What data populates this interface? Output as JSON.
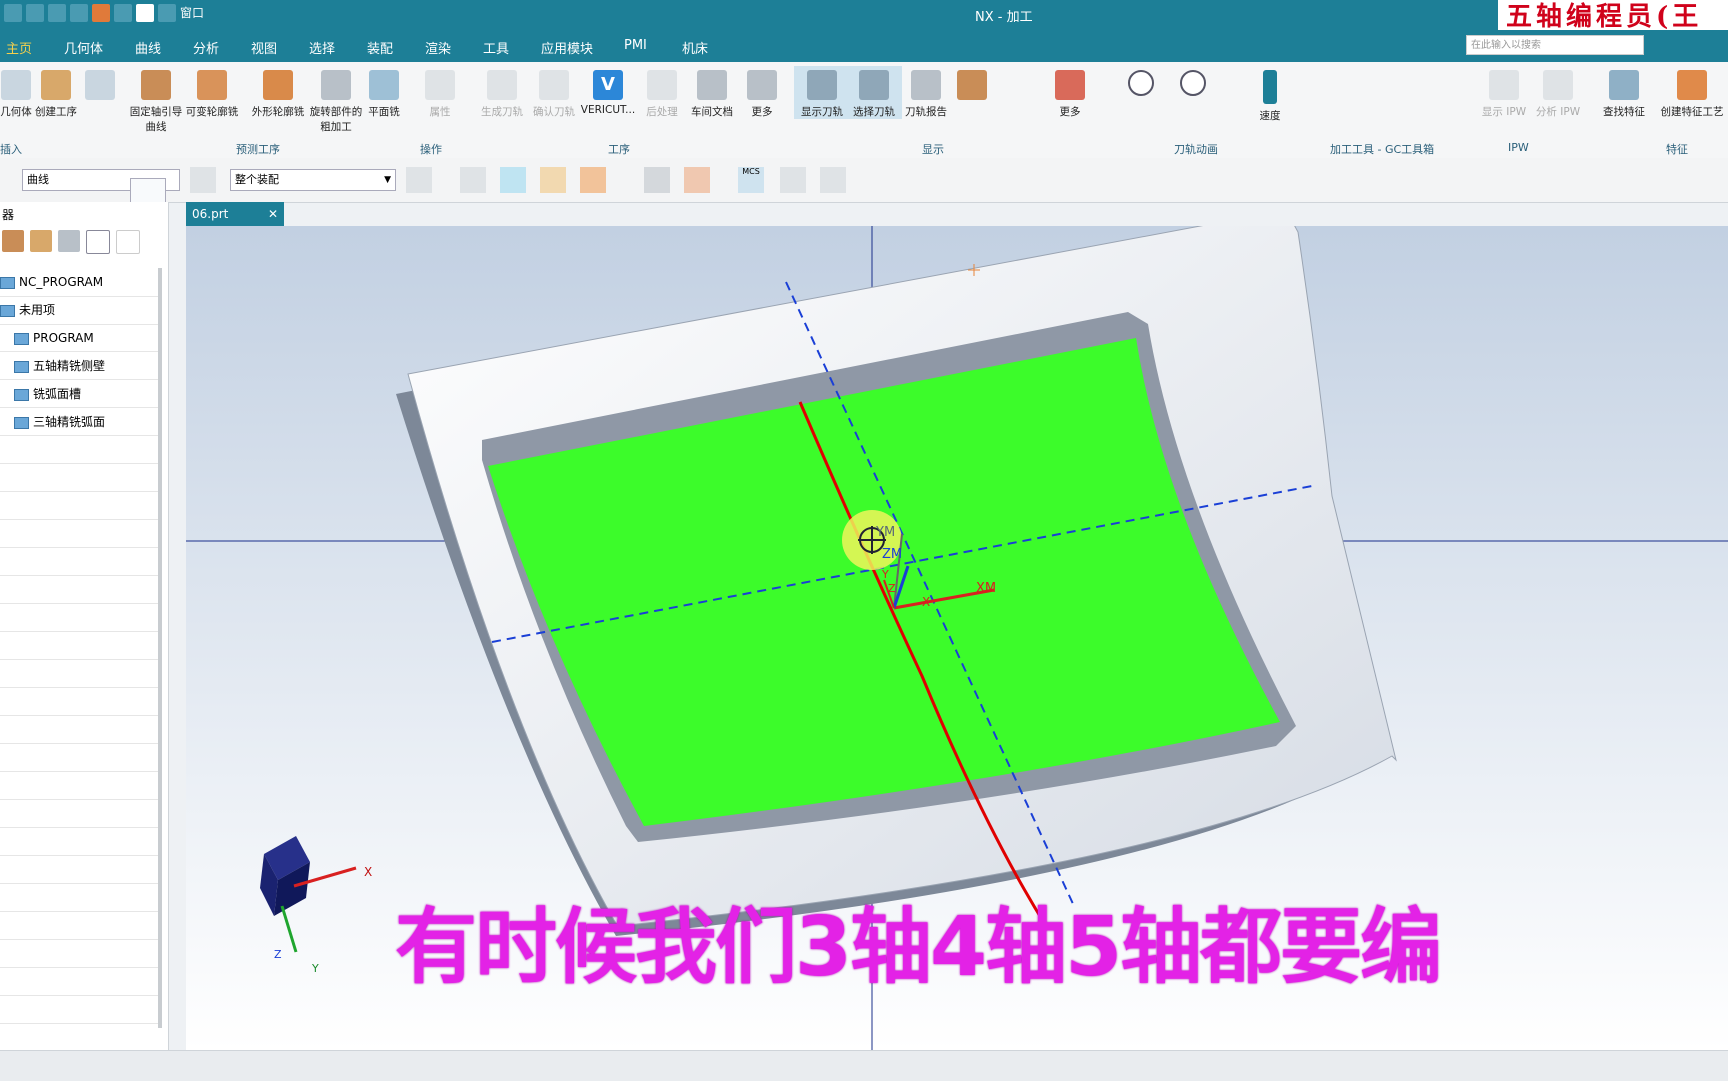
{
  "window": {
    "title": "NX - 加工",
    "brand_overlay": "五轴编程员(王"
  },
  "quick_access": {
    "window_menu": "窗口"
  },
  "menubar": {
    "items": [
      "主页",
      "几何体",
      "曲线",
      "分析",
      "视图",
      "选择",
      "装配",
      "渲染",
      "工具",
      "应用模块",
      "PMI",
      "机床"
    ],
    "active": "主页"
  },
  "search": {
    "placeholder": "在此输入以搜索"
  },
  "ribbon": {
    "buttons": [
      {
        "label": "几何体"
      },
      {
        "label": "创建工序"
      },
      {
        "label": ""
      },
      {
        "label": "固定轴引导曲线"
      },
      {
        "label": "可变轮廓铣"
      },
      {
        "label": "外形轮廓铣"
      },
      {
        "label": "旋转部件的粗加工"
      },
      {
        "label": "平面铣"
      },
      {
        "label": "属性"
      },
      {
        "label": "生成刀轨"
      },
      {
        "label": "确认刀轨"
      },
      {
        "label": "VERICUT..."
      },
      {
        "label": "后处理"
      },
      {
        "label": "车间文档"
      },
      {
        "label": "更多"
      },
      {
        "label": "显示刀轨"
      },
      {
        "label": "选择刀轨"
      },
      {
        "label": "刀轨报告"
      },
      {
        "label": ""
      },
      {
        "label": "更多"
      },
      {
        "label": "速度"
      },
      {
        "label": "显示 IPW"
      },
      {
        "label": "分析 IPW"
      },
      {
        "label": "查找特征"
      },
      {
        "label": "创建特征工艺"
      }
    ],
    "groups": [
      "插入",
      "预测工序",
      "操作",
      "工序",
      "显示",
      "刀轨动画",
      "加工工具 - GC工具箱",
      "IPW",
      "特征"
    ]
  },
  "toolbar2": {
    "filter_combo": "曲线",
    "assembly_combo": "整个装配",
    "mcs_label": "MCS"
  },
  "navigator": {
    "header": "器",
    "items": [
      {
        "label": "NC_PROGRAM",
        "indent": 0
      },
      {
        "label": "未用项",
        "indent": 0
      },
      {
        "label": "PROGRAM",
        "indent": 1
      },
      {
        "label": "五轴精铣侧壁",
        "indent": 1
      },
      {
        "label": "铣弧面槽",
        "indent": 1
      },
      {
        "label": "三轴精铣弧面",
        "indent": 1
      }
    ]
  },
  "document_tab": {
    "label": "06.prt"
  },
  "viewport": {
    "part_face_color": "#3cfc2a",
    "part_body_color": "#e9eef4",
    "axis_labels": {
      "ym": "YM",
      "zm": "ZM",
      "xm": "XM",
      "x": "X",
      "y": "Y",
      "z": "Z"
    },
    "triad_labels": {
      "x": "X",
      "y": "Y",
      "z": "Z"
    }
  },
  "subtitle": "有时候我们3轴4轴5轴都要编",
  "colors": {
    "accent": "#1d7f97",
    "subtitle": "#e322e6",
    "toolpath_red": "#e00000",
    "axis_blue": "#1a3fd6"
  }
}
